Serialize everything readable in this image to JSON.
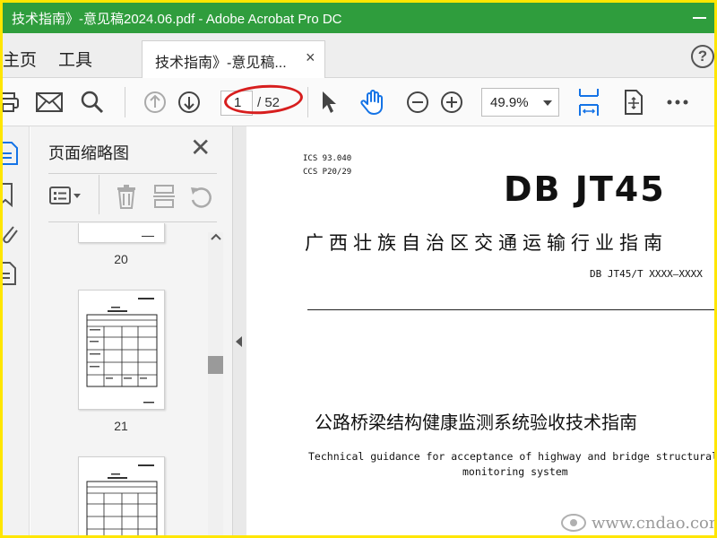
{
  "window": {
    "title": "技术指南》-意见稿2024.06.pdf - Adobe Acrobat Pro DC",
    "title_color": "#2f9d3d"
  },
  "menu": {
    "home_label": "主页",
    "tools_label": "工具"
  },
  "tab": {
    "label": "技术指南》-意见稿...",
    "close_glyph": "×"
  },
  "help": {
    "glyph": "?"
  },
  "toolbar": {
    "icons": [
      "print-icon",
      "email-icon",
      "search-icon",
      "previous-page-icon",
      "next-page-icon",
      "select-arrow-icon",
      "hand-tool-icon",
      "zoom-out-icon",
      "zoom-in-icon",
      "fit-page-icon",
      "scroll-mode-icon",
      "more-options-icon"
    ],
    "current_page": "1",
    "total_pages": "/ 52",
    "zoom": "49.9%",
    "accent_color": "#1473e6"
  },
  "panel": {
    "title": "页面缩略图",
    "close_glyph": "✕",
    "tools": [
      "page-options-icon",
      "delete-page-icon",
      "extract-page-icon",
      "rotate-page-icon"
    ],
    "thumbnails": [
      {
        "number": "20"
      },
      {
        "number": "21"
      },
      {
        "number": ""
      }
    ]
  },
  "document": {
    "ics": "ICS  93.040",
    "ccs": "CCS  P20/29",
    "standard_code": "DB JT45",
    "industry_title": "广西壮族自治区交通运输行业指南",
    "standard_number": "DB JT45/T XXXX—XXXX",
    "cn_title": "公路桥梁结构健康监测系统验收技术指南",
    "en_title_line1": "Technical guidance for acceptance of highway and bridge structural health",
    "en_title_line2": "monitoring system"
  },
  "watermark": {
    "text": "www.cndao.com"
  }
}
